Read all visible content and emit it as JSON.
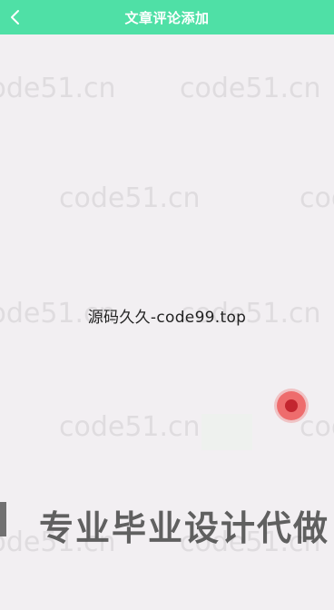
{
  "header": {
    "title": "文章评论添加",
    "background": "#4fe0a6"
  },
  "content": {
    "center_text": "源码久久-code99.top",
    "banner_text": "专业毕业设计代做"
  },
  "watermark": {
    "text": "code51.cn"
  },
  "colors": {
    "page_background": "#f2eff2",
    "accent": "#4fe0a6",
    "float_button": "#ec4040"
  },
  "icons": {
    "back": "chevron-left-icon",
    "float": "record-dot-icon"
  }
}
